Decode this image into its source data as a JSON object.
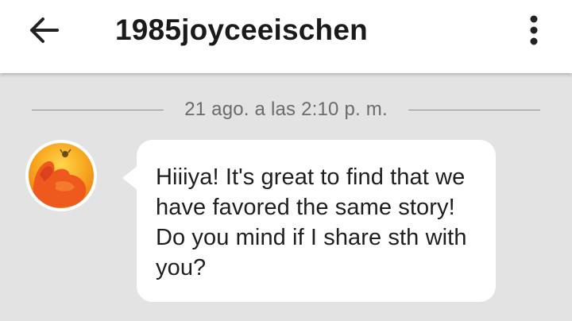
{
  "header": {
    "back_icon": "arrow-left-icon",
    "title": "1985joyceeischen",
    "menu_icon": "more-vertical-icon"
  },
  "conversation": {
    "timestamp": "21 ago. a las 2:10 p. m.",
    "messages": [
      {
        "sender_avatar": "avatar-icon",
        "text": "Hiiiya! It's great to find that we have favored the same story! Do you mind if I share sth with you?"
      }
    ]
  },
  "colors": {
    "background": "#e3e3e3",
    "app_bar": "#ffffff",
    "bubble": "#ffffff",
    "timestamp_text": "#6b6b6b"
  }
}
